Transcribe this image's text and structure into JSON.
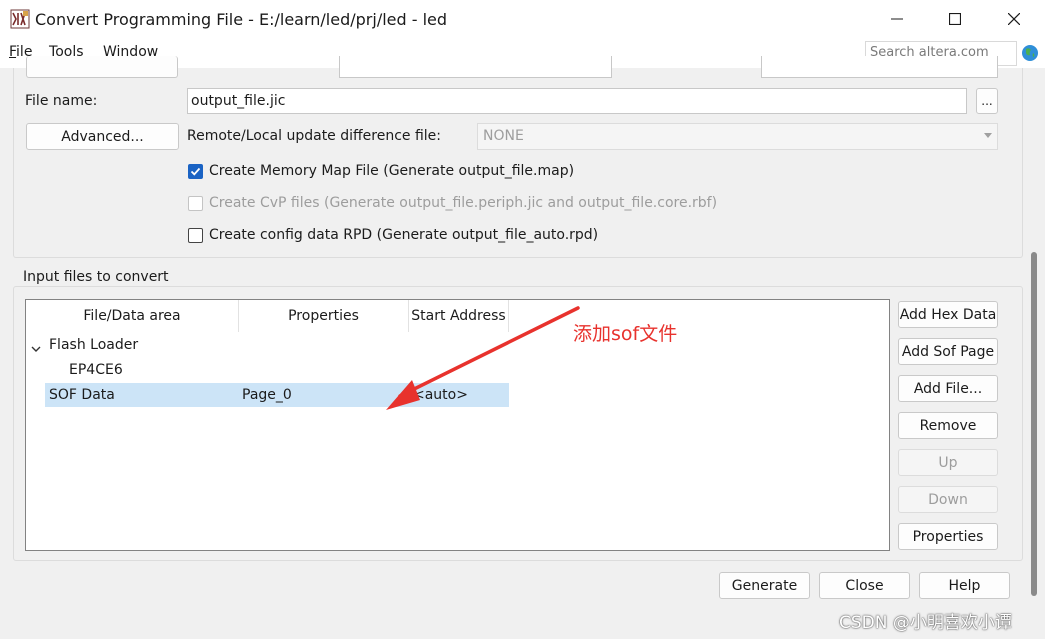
{
  "window": {
    "title": "Convert Programming File - E:/learn/led/prj/led - led",
    "controls": [
      "minimize",
      "maximize",
      "close"
    ]
  },
  "menu": {
    "items": [
      {
        "label": "File",
        "underline": "F",
        "rest": "ile"
      },
      {
        "label": "Tools",
        "underline": "T",
        "rest": "ools"
      },
      {
        "label": "Window",
        "underline": "W",
        "rest": "indow"
      }
    ],
    "search_placeholder": "Search altera.com"
  },
  "output": {
    "file_name_label": "File name:",
    "file_name_value": "output_file.jic",
    "browse_label": "...",
    "advanced_label": "Advanced...",
    "remote_update_label": "Remote/Local update difference file:",
    "remote_update_value": "NONE",
    "options": [
      {
        "label": "Create Memory Map File (Generate output_file.map)",
        "checked": true,
        "enabled": true
      },
      {
        "label": "Create CvP files (Generate output_file.periph.jic and output_file.core.rbf)",
        "checked": false,
        "enabled": false
      },
      {
        "label": "Create config data RPD (Generate output_file_auto.rpd)",
        "checked": false,
        "enabled": true
      }
    ]
  },
  "input_files": {
    "group_label": "Input files to convert",
    "columns": [
      "File/Data area",
      "Properties",
      "Start Address"
    ],
    "rows": [
      {
        "name": "Flash Loader",
        "properties": "",
        "start": "",
        "level": 0,
        "expanded": true
      },
      {
        "name": "EP4CE6",
        "properties": "",
        "start": "",
        "level": 1
      },
      {
        "name": "SOF Data",
        "properties": "Page_0",
        "start": "<auto>",
        "level": 0,
        "selected": true
      }
    ],
    "side_buttons": [
      {
        "label": "Add Hex Data",
        "enabled": true
      },
      {
        "label": "Add Sof Page",
        "enabled": true
      },
      {
        "label": "Add File...",
        "enabled": true
      },
      {
        "label": "Remove",
        "enabled": true
      },
      {
        "label": "Up",
        "enabled": false
      },
      {
        "label": "Down",
        "enabled": false
      },
      {
        "label": "Properties",
        "enabled": true
      }
    ]
  },
  "footer": {
    "generate_label": "Generate",
    "close_label": "Close",
    "help_label": "Help"
  },
  "annotation": {
    "text": "添加sof文件",
    "color": "#e8322d"
  },
  "watermark": "CSDN @小明喜欢小谭",
  "colors": {
    "accent": "#1a63c4",
    "selection": "#cce4f7"
  }
}
